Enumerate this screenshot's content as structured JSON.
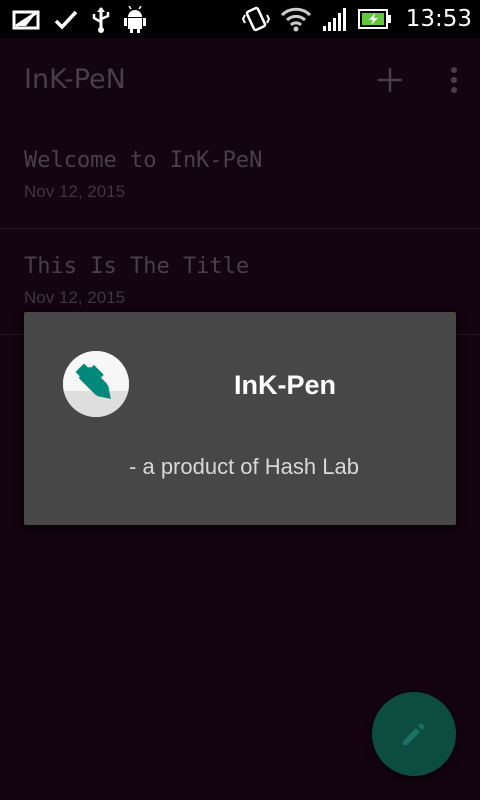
{
  "status_bar": {
    "time": "13:53",
    "icons": [
      "screen-capture-icon",
      "check-icon",
      "usb-icon",
      "android-debug-icon",
      "vibrate-icon",
      "wifi-icon",
      "signal-icon",
      "battery-charging-icon"
    ]
  },
  "appbar": {
    "title": "InK-PeN",
    "actions": [
      "add-icon",
      "more-vert-icon"
    ]
  },
  "notes": [
    {
      "title": "Welcome to InK-PeN",
      "date": "Nov 12, 2015"
    },
    {
      "title": "This Is The Title",
      "date": "Nov 12, 2015"
    }
  ],
  "about_dialog": {
    "title": "InK-Pen",
    "subtitle": "- a product of Hash Lab",
    "icon": "pen-icon"
  },
  "fab": {
    "icon": "edit-icon"
  },
  "colors": {
    "background": "#13040f",
    "dialog": "#474747",
    "accent": "#00897b",
    "fab": "#0c4d3f"
  }
}
